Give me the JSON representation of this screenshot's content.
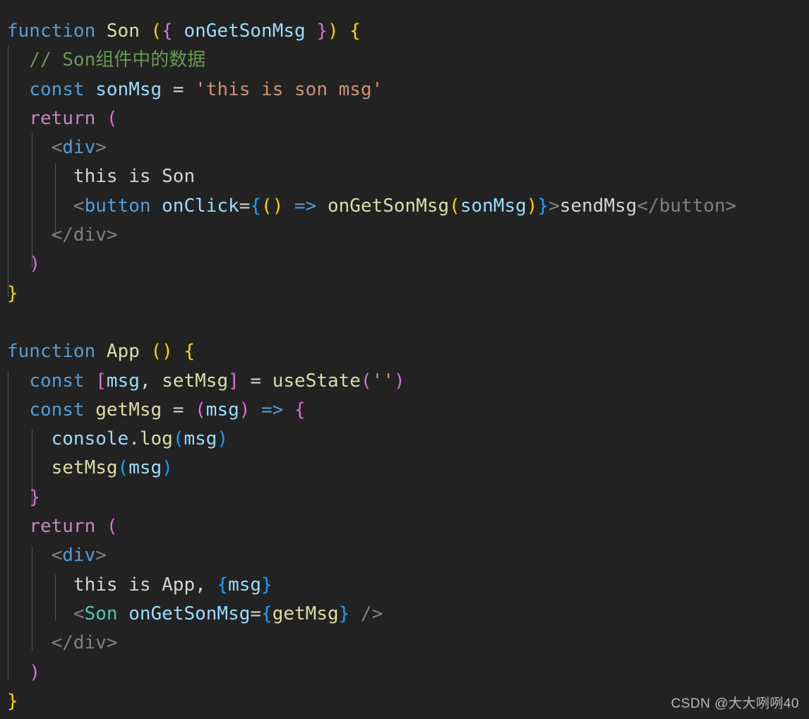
{
  "editor": {
    "background_color": "#222222",
    "font_size_px": 26,
    "line_height_px": 41.3,
    "language": "jsx",
    "theme": "Dark+ (default dark)"
  },
  "colors": {
    "keyword": "#569CD6",
    "control_keyword": "#C586C0",
    "function": "#DCDCAA",
    "variable": "#9CDCFE",
    "component": "#4EC9B0",
    "string": "#CE9178",
    "comment": "#6A9955",
    "text": "#D4D4D4",
    "tag_bracket": "#808080",
    "bracket_yellow": "#FFD700",
    "bracket_magenta": "#DA70D6",
    "bracket_blue": "#179FFF",
    "indent_guide": "#555555"
  },
  "code": {
    "lines": [
      "function Son ({ onGetSonMsg }) {",
      "  // Son组件中的数据",
      "  const sonMsg = 'this is son msg'",
      "  return (",
      "    <div>",
      "      this is Son",
      "      <button onClick={() => onGetSonMsg(sonMsg)}>sendMsg</button>",
      "    </div>",
      "  )",
      "}",
      "",
      "function App () {",
      "  const [msg, setMsg] = useState('')",
      "  const getMsg = (msg) => {",
      "    console.log(msg)",
      "    setMsg(msg)",
      "  }",
      "  return (",
      "    <div>",
      "      this is App, {msg}",
      "      <Son onGetSonMsg={getMsg} />",
      "    </div>",
      "  )",
      "}"
    ],
    "tokens": {
      "l1": {
        "kw_function": "function",
        "fn_name": "Son",
        "paren_open": "(",
        "brace_open": "{",
        "prop": "onGetSonMsg",
        "brace_close": "}",
        "paren_close": ")",
        "body_open": "{"
      },
      "l2": {
        "comment": "// Son组件中的数据"
      },
      "l3": {
        "kw_const": "const",
        "var_name": "sonMsg",
        "equals": "=",
        "string": "'this is son msg'"
      },
      "l4": {
        "kw_return": "return",
        "paren_open": "("
      },
      "l5": {
        "lt": "<",
        "tag": "div",
        "gt": ">"
      },
      "l6": {
        "text": "this is Son"
      },
      "l7": {
        "lt": "<",
        "tag": "button",
        "attr": "onClick",
        "equals": "=",
        "brace_open": "{",
        "arrow_params": "()",
        "arrow": "=>",
        "call_fn": "onGetSonMsg",
        "call_paren_open": "(",
        "call_arg": "sonMsg",
        "call_paren_close": ")",
        "brace_close": "}",
        "gt": ">",
        "text": "sendMsg",
        "close_tag": "</button>"
      },
      "l8": {
        "close_tag": "</div>"
      },
      "l9": {
        "paren_close": ")"
      },
      "l10": {
        "brace_close": "}"
      },
      "l12": {
        "kw_function": "function",
        "fn_name": "App",
        "parens": "()",
        "body_open": "{"
      },
      "l13": {
        "kw_const": "const",
        "bracket_open": "[",
        "state_var": "msg",
        "comma": ",",
        "state_setter": "setMsg",
        "bracket_close": "]",
        "equals": "=",
        "hook": "useState",
        "paren_open": "(",
        "string": "''",
        "paren_close": ")"
      },
      "l14": {
        "kw_const": "const",
        "fn_name": "getMsg",
        "equals": "=",
        "paren_open": "(",
        "param": "msg",
        "paren_close": ")",
        "arrow": "=>",
        "body_open": "{"
      },
      "l15": {
        "obj": "console",
        "dot": ".",
        "method": "log",
        "paren_open": "(",
        "arg": "msg",
        "paren_close": ")"
      },
      "l16": {
        "fn": "setMsg",
        "paren_open": "(",
        "arg": "msg",
        "paren_close": ")"
      },
      "l17": {
        "brace_close": "}"
      },
      "l18": {
        "kw_return": "return",
        "paren_open": "("
      },
      "l19": {
        "lt": "<",
        "tag": "div",
        "gt": ">"
      },
      "l20": {
        "text": "this is App, ",
        "brace_open": "{",
        "expr": "msg",
        "brace_close": "}"
      },
      "l21": {
        "lt": "<",
        "component": "Son",
        "attr": "onGetSonMsg",
        "equals": "=",
        "brace_open": "{",
        "value": "getMsg",
        "brace_close": "}",
        "self_close": "/>"
      },
      "l22": {
        "close_tag": "</div>"
      },
      "l23": {
        "paren_close": ")"
      },
      "l24": {
        "brace_close": "}"
      }
    }
  },
  "watermark": {
    "text": "CSDN @大大咧咧40"
  }
}
